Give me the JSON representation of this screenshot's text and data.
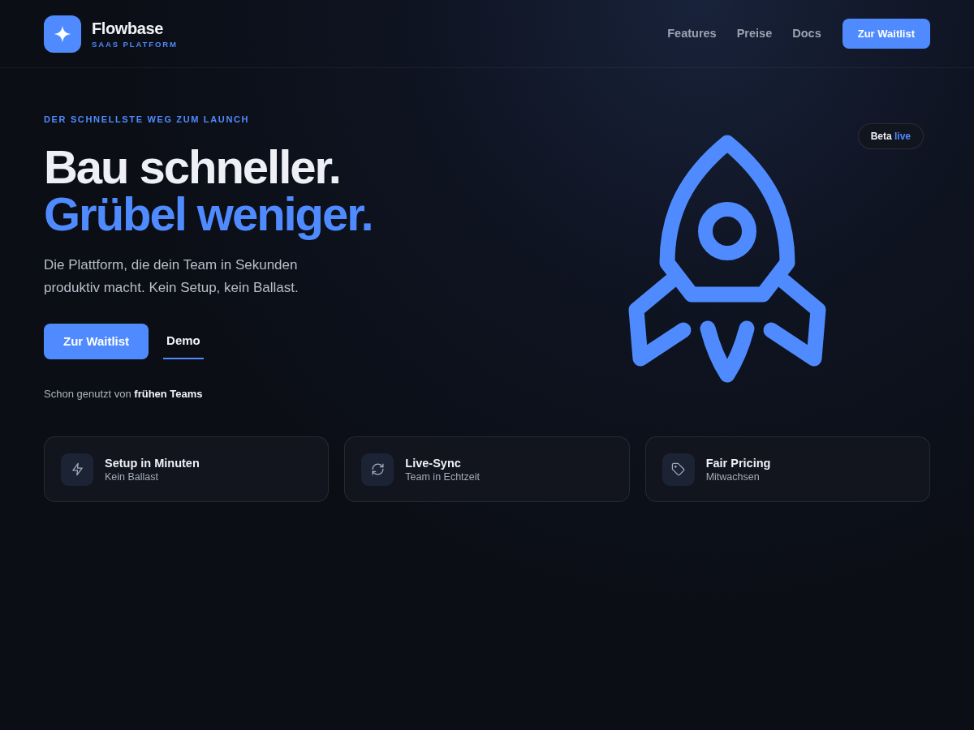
{
  "header": {
    "brand": {
      "name": "Flowbase",
      "tagline": "SAAS PLATFORM"
    },
    "nav": [
      {
        "label": "Features"
      },
      {
        "label": "Preise"
      },
      {
        "label": "Docs"
      }
    ],
    "cta": "Zur Waitlist"
  },
  "hero": {
    "eyebrow": "DER SCHNELLSTE WEG ZUM LAUNCH",
    "headline": [
      {
        "text": "Bau schneller.",
        "accent": false
      },
      {
        "text": "Grübel weniger.",
        "accent": true
      }
    ],
    "subtitle": "Die Plattform, die dein Team in Sekunden produktiv macht. Kein Setup, kein Ballast.",
    "buttons": [
      {
        "label": "Zur Waitlist",
        "kind": "primary"
      },
      {
        "label": "Demo",
        "kind": "link"
      }
    ],
    "social_proof": "Schon genutzt von **frühen Teams**",
    "badge": {
      "label": "Beta",
      "status": "live"
    }
  },
  "features": [
    {
      "title": "Setup in Minuten",
      "subtitle": "Kein Ballast"
    },
    {
      "title": "Live-Sync",
      "subtitle": "Team in Echtzeit"
    },
    {
      "title": "Fair Pricing",
      "subtitle": "Mitwachsen"
    }
  ]
}
